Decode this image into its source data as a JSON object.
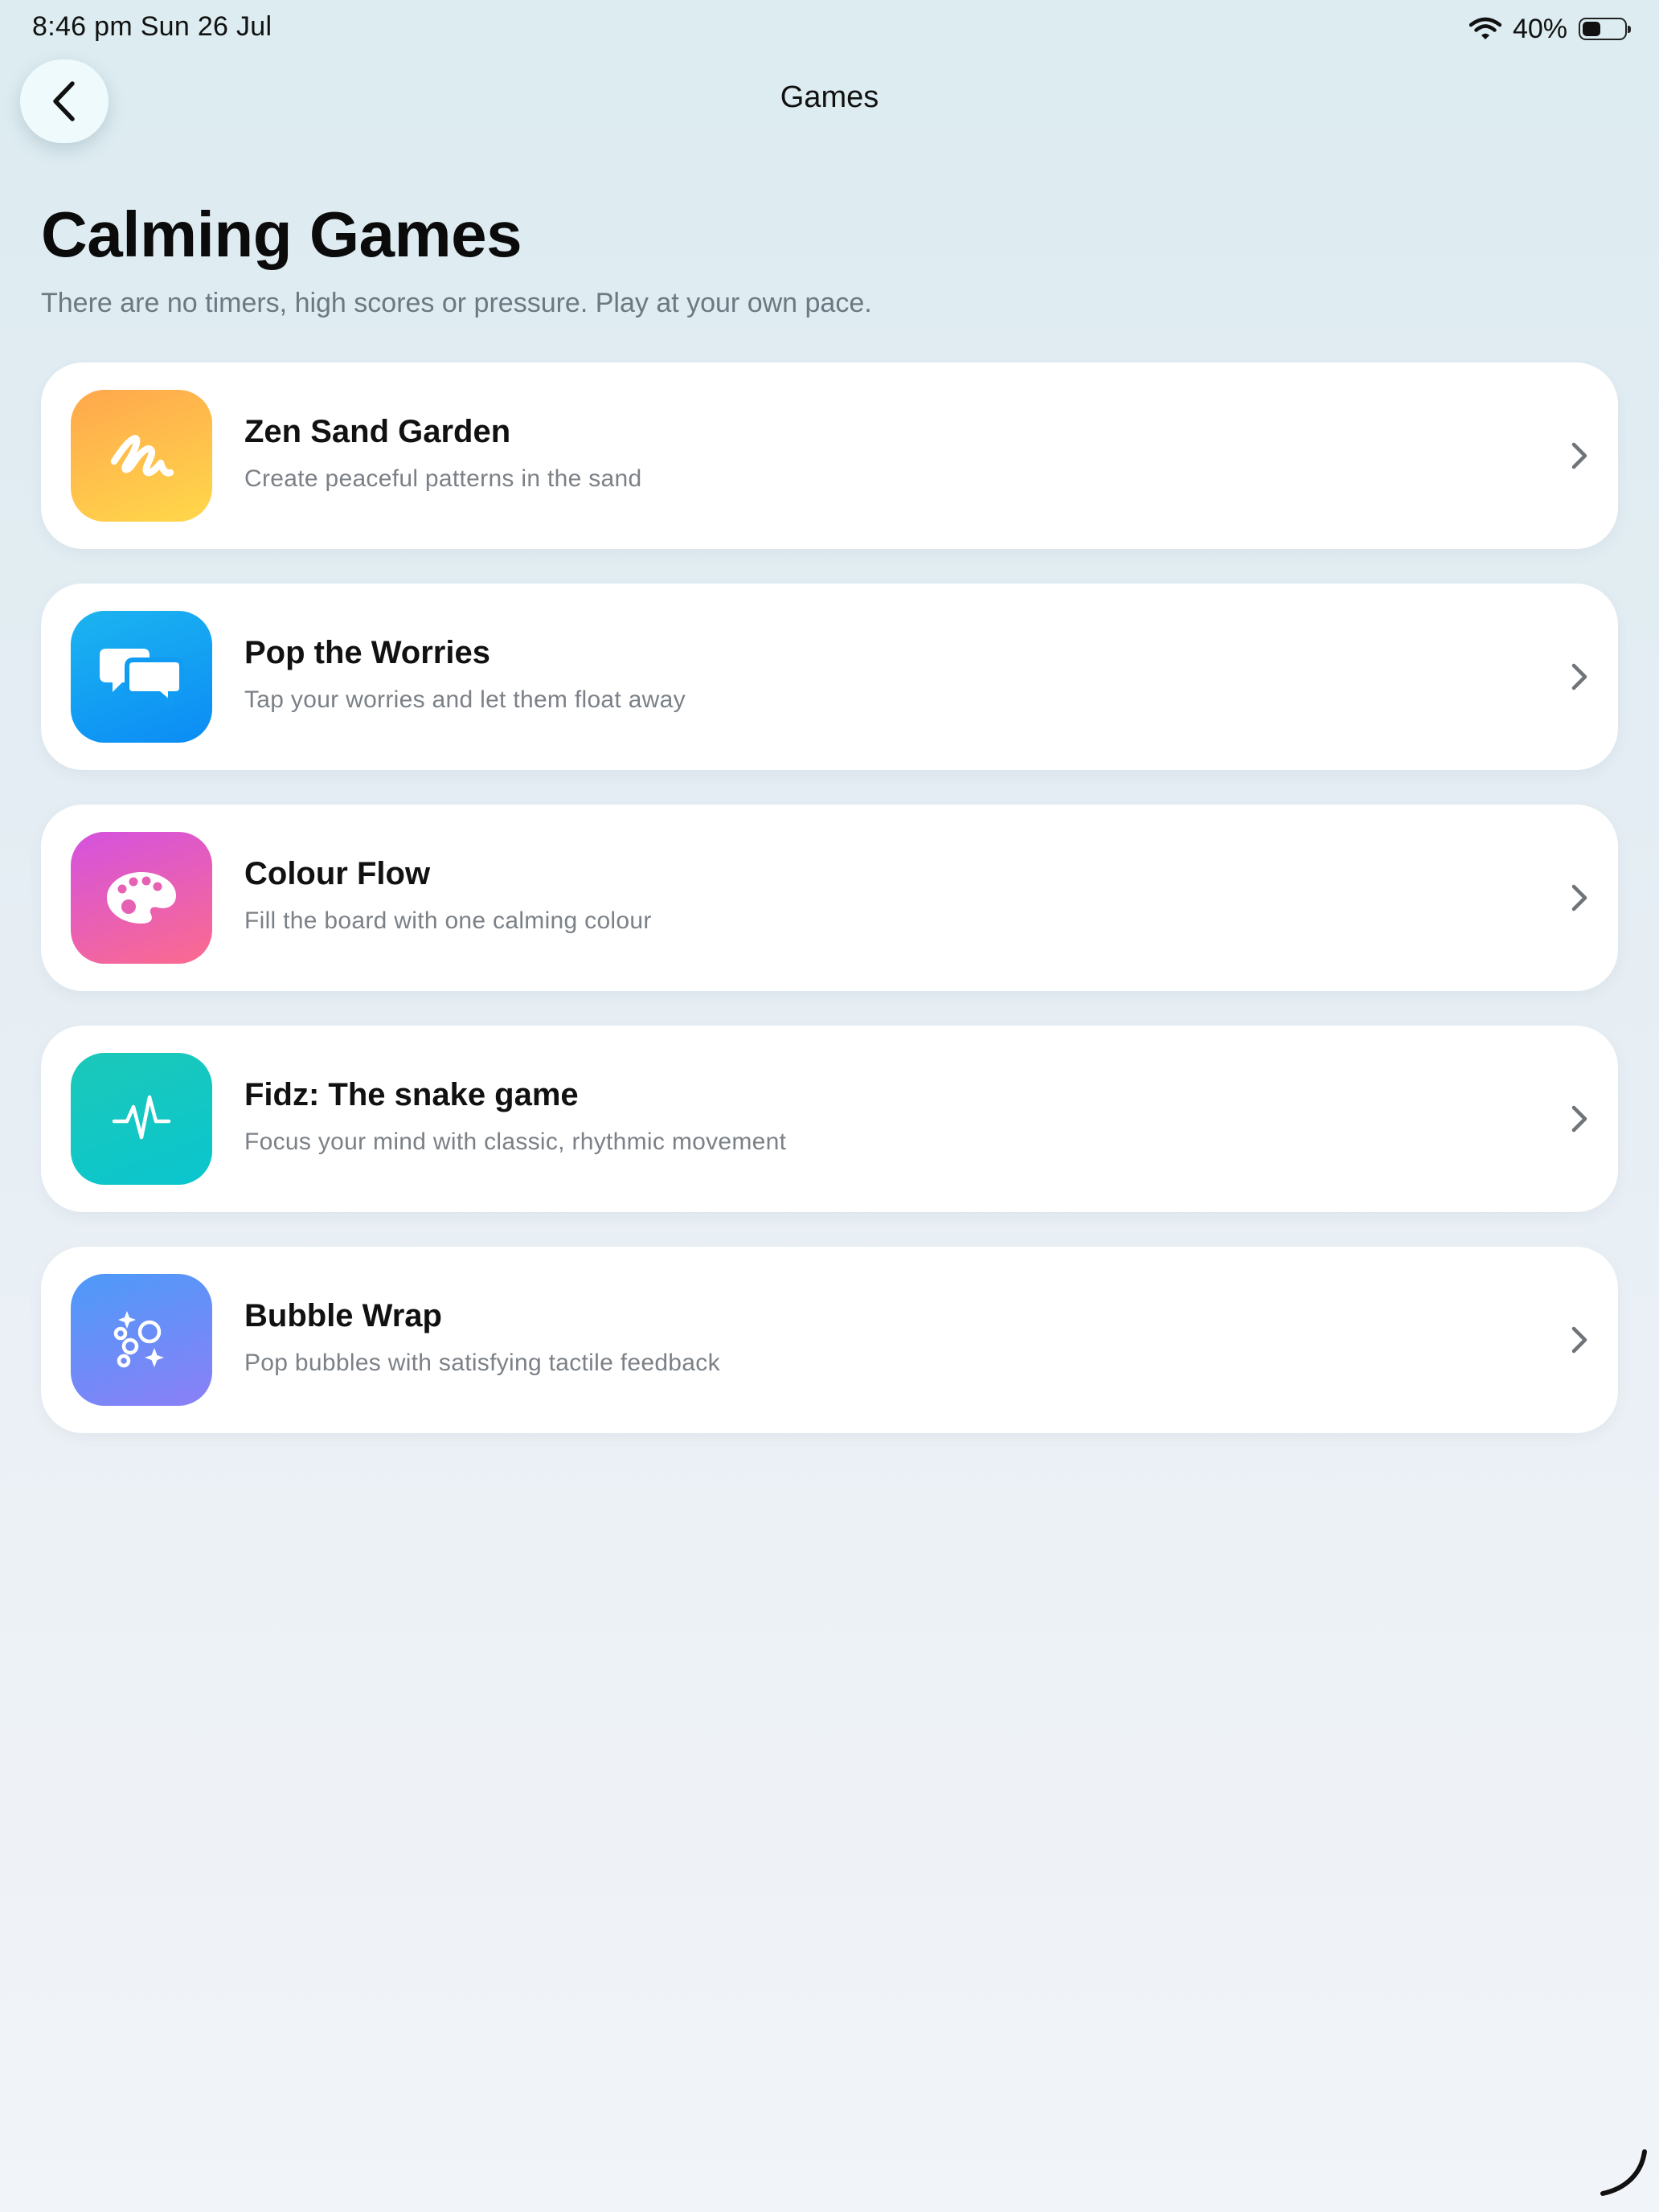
{
  "status_bar": {
    "time": "8:46 pm   Sun 26 Jul",
    "battery_percent": "40%",
    "battery_level": 0.4
  },
  "nav": {
    "title": "Games",
    "back_icon": "chevron-left-icon"
  },
  "header": {
    "title": "Calming Games",
    "subtitle": "There are no timers, high scores or pressure. Play at your own pace."
  },
  "games": [
    {
      "title": "Zen Sand Garden",
      "description": "Create peaceful patterns in the sand",
      "icon": "scribble-icon",
      "gradient": [
        "#ffa74d",
        "#ffd84a"
      ]
    },
    {
      "title": "Pop the Worries",
      "description": "Tap your worries and let them float away",
      "icon": "chat-bubbles-icon",
      "gradient": [
        "#1cb4f0",
        "#0b8cf5"
      ]
    },
    {
      "title": "Colour Flow",
      "description": "Fill the board with one calming colour",
      "icon": "palette-icon",
      "gradient": [
        "#d452df",
        "#fb6b8e"
      ]
    },
    {
      "title": "Fidz: The snake game",
      "description": "Focus your mind with classic, rhythmic movement",
      "icon": "pulse-icon",
      "gradient": [
        "#1bc8b8",
        "#0ac6cf"
      ]
    },
    {
      "title": "Bubble Wrap",
      "description": "Pop bubbles with satisfying tactile feedback",
      "icon": "bubbles-icon",
      "gradient": [
        "#4c9bf9",
        "#8b7ff6"
      ]
    }
  ]
}
